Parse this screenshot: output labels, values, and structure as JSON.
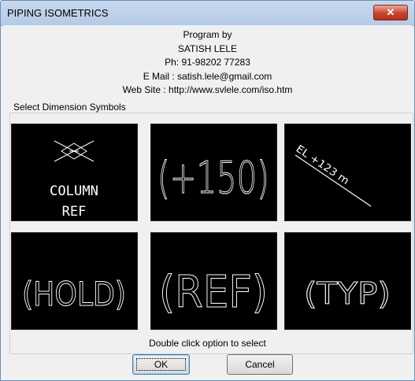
{
  "window": {
    "title": "PIPING ISOMETRICS",
    "close_glyph": "✕"
  },
  "info": {
    "line1": "Program by",
    "line2": "SATISH LELE",
    "line3": "Ph: 91-98202 77283",
    "line4": "E Mail : satish.lele@gmail.com",
    "line5": "Web Site : http://www.svlele.com/iso.htm"
  },
  "group": {
    "label": "Select Dimension Symbols"
  },
  "symbols": [
    {
      "id": "column-ref",
      "lines": [
        "COLUMN",
        "REF"
      ]
    },
    {
      "id": "plus-150",
      "text": "(+150)"
    },
    {
      "id": "el-123",
      "text": "EL +123 m"
    },
    {
      "id": "hold",
      "text": "(HOLD)"
    },
    {
      "id": "ref",
      "text": "(REF)"
    },
    {
      "id": "typ",
      "text": "(TYP)"
    }
  ],
  "footer": {
    "hint": "Double click option to select",
    "ok_label": "OK",
    "cancel_label": "Cancel"
  },
  "colors": {
    "symbol_bg": "#000000",
    "symbol_stroke": "#ffffff",
    "titlebar": "#b9cfe9",
    "close_button": "#c7442c"
  }
}
